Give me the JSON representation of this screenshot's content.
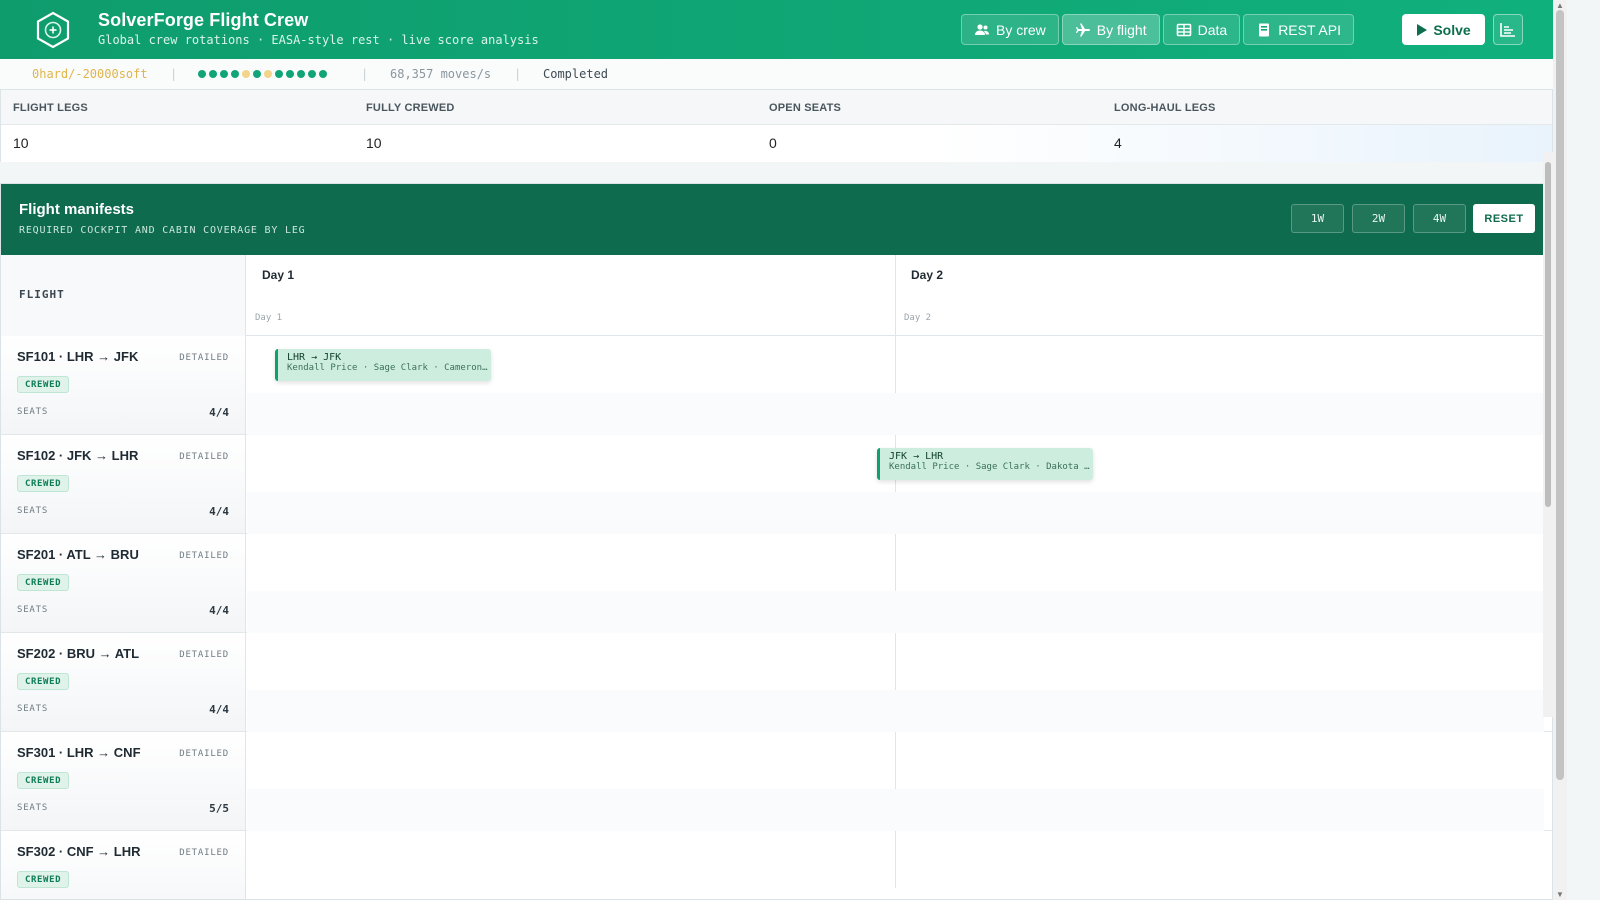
{
  "header": {
    "title": "SolverForge Flight Crew",
    "subtitle": "Global crew rotations · EASA-style rest · live score analysis",
    "nav": [
      {
        "label": "By crew",
        "icon": "users-icon"
      },
      {
        "label": "By flight",
        "icon": "plane-icon"
      },
      {
        "label": "Data",
        "icon": "table-icon"
      },
      {
        "label": "REST API",
        "icon": "book-icon"
      }
    ],
    "solve_label": "Solve",
    "colors": {
      "brand": "#10a774",
      "brand_dark": "#0f6b4d"
    }
  },
  "status": {
    "score": "0hard/-20000soft",
    "moves": "68,357 moves/s",
    "state": "Completed",
    "dot_colors": [
      "#11a477",
      "#11a477",
      "#11a477",
      "#11a477",
      "#f2d48a",
      "#11a477",
      "#f2d48a",
      "#11a477",
      "#11a477",
      "#11a477",
      "#11a477",
      "#11a477"
    ]
  },
  "stats": {
    "headers": [
      "FLIGHT LEGS",
      "FULLY CREWED",
      "OPEN SEATS",
      "LONG-HAUL LEGS"
    ],
    "values": [
      "10",
      "10",
      "0",
      "4"
    ]
  },
  "manifest": {
    "title": "Flight manifests",
    "subtitle": "REQUIRED COCKPIT AND CABIN COVERAGE BY LEG",
    "zoom": [
      "1W",
      "2W",
      "4W"
    ],
    "reset_label": "RESET",
    "flight_col_label": "FLIGHT",
    "days": [
      {
        "title": "Day 1",
        "sub": "Day 1"
      },
      {
        "title": "Day 2",
        "sub": "Day 2"
      }
    ],
    "mode_label": "DETAILED",
    "seats_label": "SEATS",
    "rows": [
      {
        "name": "SF101 · LHR → JFK",
        "badge": "CREWED",
        "seats": "4/4",
        "leg": {
          "route": "LHR → JFK",
          "crew": "Kendall Price · Sage Clark · Cameron…"
        }
      },
      {
        "name": "SF102 · JFK → LHR",
        "badge": "CREWED",
        "seats": "4/4",
        "leg": {
          "route": "JFK → LHR",
          "crew": "Kendall Price · Sage Clark · Dakota …"
        }
      },
      {
        "name": "SF201 · ATL → BRU",
        "badge": "CREWED",
        "seats": "4/4"
      },
      {
        "name": "SF202 · BRU → ATL",
        "badge": "CREWED",
        "seats": "4/4"
      },
      {
        "name": "SF301 · LHR → CNF",
        "badge": "CREWED",
        "seats": "5/5"
      },
      {
        "name": "SF302 · CNF → LHR",
        "badge": "CREWED",
        "seats": ""
      }
    ]
  }
}
